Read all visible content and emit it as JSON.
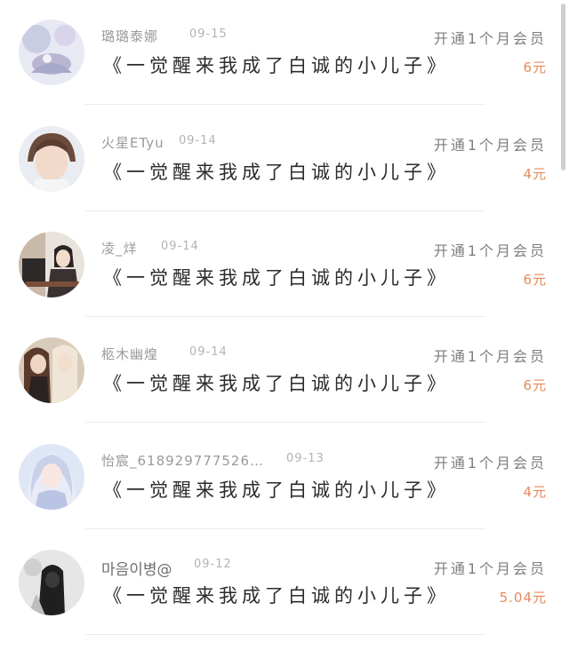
{
  "items": [
    {
      "name": "璐璐泰娜",
      "date": "09-15",
      "title": "《一觉醒来我成了白诚的小儿子》",
      "action": "开通1个月会员",
      "price": "6元"
    },
    {
      "name": "火星ETyu",
      "date": "09-14",
      "title": "《一觉醒来我成了白诚的小儿子》",
      "action": "开通1个月会员",
      "price": "4元"
    },
    {
      "name": "凌_烊",
      "date": "09-14",
      "title": "《一觉醒来我成了白诚的小儿子》",
      "action": "开通1个月会员",
      "price": "6元"
    },
    {
      "name": "柩木幽煌",
      "date": "09-14",
      "title": "《一觉醒来我成了白诚的小儿子》",
      "action": "开通1个月会员",
      "price": "6元"
    },
    {
      "name": "怡宸_618929777526…",
      "date": "09-13",
      "title": "《一觉醒来我成了白诚的小儿子》",
      "action": "开通1个月会员",
      "price": "4元"
    },
    {
      "name": "마음이병@",
      "date": "09-12",
      "title": "《一觉醒来我成了白诚的小儿子》",
      "action": "开通1个月会员",
      "price": "5.04元"
    }
  ]
}
